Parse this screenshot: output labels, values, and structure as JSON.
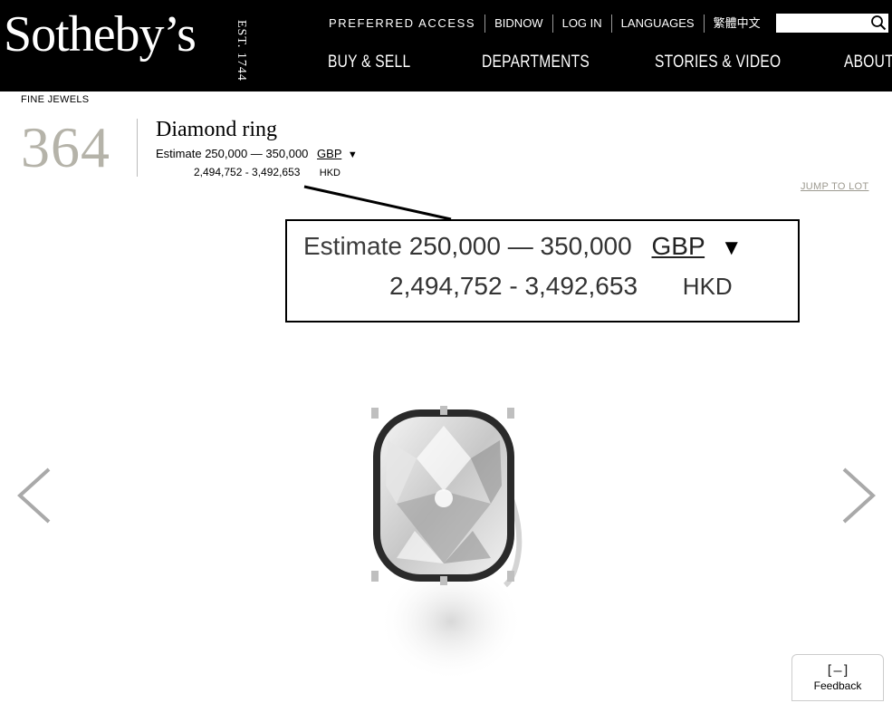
{
  "brand": {
    "logo": "Sotheby’s",
    "est": "EST. 1744"
  },
  "top_nav": {
    "preferred_access": "PREFERRED ACCESS",
    "bidnow": "BIDNOW",
    "login": "LOG IN",
    "languages": "LANGUAGES",
    "chinese": "繁體中文"
  },
  "search": {
    "value": ""
  },
  "main_nav": {
    "buy_sell": "BUY & SELL",
    "departments": "DEPARTMENTS",
    "stories_video": "STORIES & VIDEO",
    "about": "ABOUT"
  },
  "lot": {
    "department": "FINE JEWELS",
    "number": "364",
    "title": "Diamond ring",
    "estimate_label": "Estimate",
    "estimate_range": "250,000 — 350,000",
    "currency": "GBP",
    "converted_range": "2,494,752 - 3,492,653",
    "converted_currency": "HKD",
    "jump_label": "JUMP TO LOT"
  },
  "feedback": {
    "icon_text": "[–]",
    "label": "Feedback"
  },
  "colors": {
    "header_bg": "#000000",
    "lot_number": "#b5b3a9",
    "jump_link": "#9d9a90"
  },
  "icons": {
    "search": "search-icon",
    "prev": "chevron-left-icon",
    "next": "chevron-right-icon",
    "dropdown": "caret-down-icon"
  }
}
